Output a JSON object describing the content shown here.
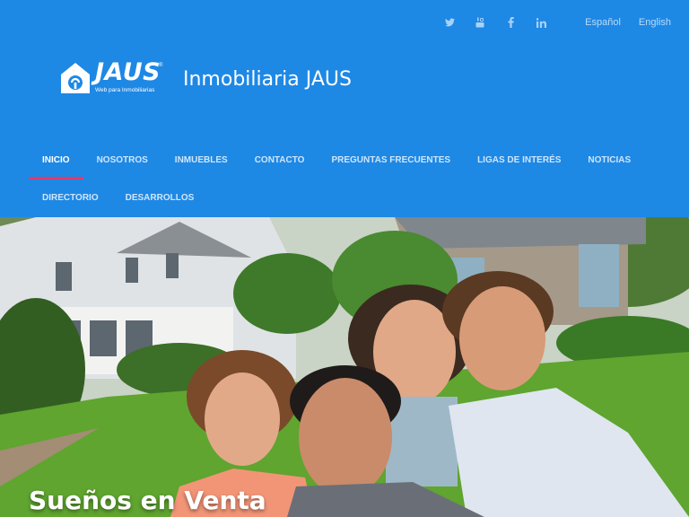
{
  "topbar": {
    "social": [
      {
        "name": "twitter-icon",
        "glyph": "🐦"
      },
      {
        "name": "youtube-icon",
        "glyph": "▶"
      },
      {
        "name": "facebook-icon",
        "glyph": "f"
      },
      {
        "name": "linkedin-icon",
        "glyph": "in"
      }
    ],
    "languages": [
      "Español",
      "English"
    ]
  },
  "brand": {
    "logo_word": "JAUS",
    "logo_reg": "®",
    "logo_tagline": "Web para Inmobiliarias",
    "site_name": "Inmobiliaria JAUS"
  },
  "nav": {
    "row1": [
      "INICIO",
      "NOSOTROS",
      "INMUEBLES",
      "CONTACTO",
      "PREGUNTAS FRECUENTES",
      "LIGAS DE INTERÉS",
      "NOTICIAS"
    ],
    "row2": [
      "DIRECTORIO",
      "DESARROLLOS"
    ],
    "active": "INICIO"
  },
  "hero": {
    "title": "Sueños en Venta"
  },
  "colors": {
    "header_bg": "#1e88e5",
    "active_underline": "#e53966"
  }
}
